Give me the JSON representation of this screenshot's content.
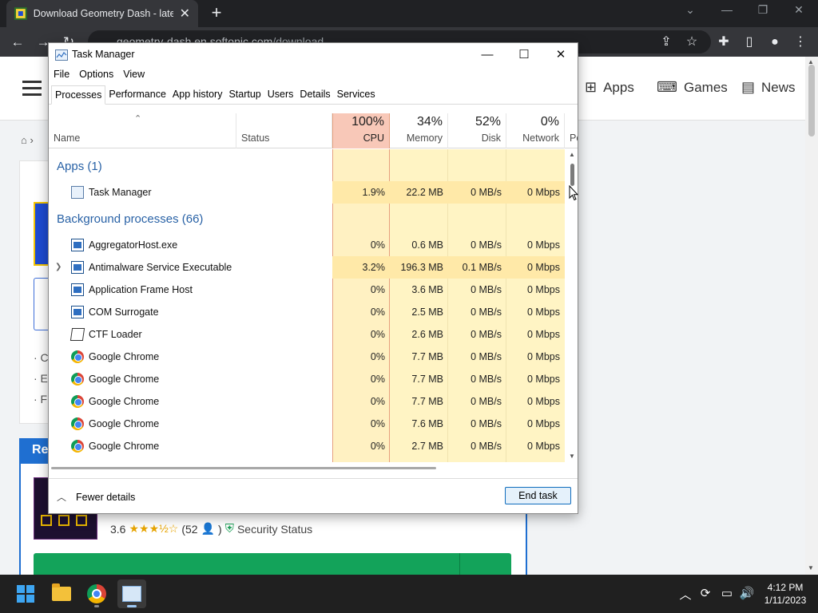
{
  "browser": {
    "tab_title": "Download Geometry Dash - latest",
    "new_tab_label": "+",
    "address_host": "geometry-dash.en.softonic.com",
    "address_path": "/download"
  },
  "site": {
    "nav": [
      {
        "label": "Apps",
        "icon": "apps-grid-icon"
      },
      {
        "label": "Games",
        "icon": "gamepad-icon"
      },
      {
        "label": "News",
        "icon": "news-icon"
      }
    ],
    "breadcrumb_home": "⌂ ›",
    "bullets": [
      "· C",
      "· E",
      "· F"
    ],
    "related_head": "Re",
    "rating": "3.6",
    "reviews": "(52",
    "reviews_close": ")",
    "security": "Security Status"
  },
  "taskmanager": {
    "title": "Task Manager",
    "menu": [
      "File",
      "Options",
      "View"
    ],
    "tabs": [
      "Processes",
      "Performance",
      "App history",
      "Startup",
      "Users",
      "Details",
      "Services"
    ],
    "columns": {
      "name": "Name",
      "status": "Status",
      "cpu_pct": "100%",
      "cpu": "CPU",
      "mem_pct": "34%",
      "mem": "Memory",
      "disk_pct": "52%",
      "disk": "Disk",
      "net_pct": "0%",
      "net": "Network",
      "power": "Po"
    },
    "groups": {
      "apps": "Apps (1)",
      "background": "Background processes (66)"
    },
    "app_rows": [
      {
        "name": "Task Manager",
        "cpu": "1.9%",
        "mem": "22.2 MB",
        "disk": "0 MB/s",
        "net": "0 Mbps"
      }
    ],
    "bg_rows": [
      {
        "name": "AggregatorHost.exe",
        "cpu": "0%",
        "mem": "0.6 MB",
        "disk": "0 MB/s",
        "net": "0 Mbps"
      },
      {
        "name": "Antimalware Service Executable",
        "cpu": "3.2%",
        "mem": "196.3 MB",
        "disk": "0.1 MB/s",
        "net": "0 Mbps"
      },
      {
        "name": "Application Frame Host",
        "cpu": "0%",
        "mem": "3.6 MB",
        "disk": "0 MB/s",
        "net": "0 Mbps"
      },
      {
        "name": "COM Surrogate",
        "cpu": "0%",
        "mem": "2.5 MB",
        "disk": "0 MB/s",
        "net": "0 Mbps"
      },
      {
        "name": "CTF Loader",
        "cpu": "0%",
        "mem": "2.6 MB",
        "disk": "0 MB/s",
        "net": "0 Mbps"
      },
      {
        "name": "Google Chrome",
        "cpu": "0%",
        "mem": "7.7 MB",
        "disk": "0 MB/s",
        "net": "0 Mbps"
      },
      {
        "name": "Google Chrome",
        "cpu": "0%",
        "mem": "7.7 MB",
        "disk": "0 MB/s",
        "net": "0 Mbps"
      },
      {
        "name": "Google Chrome",
        "cpu": "0%",
        "mem": "7.7 MB",
        "disk": "0 MB/s",
        "net": "0 Mbps"
      },
      {
        "name": "Google Chrome",
        "cpu": "0%",
        "mem": "7.6 MB",
        "disk": "0 MB/s",
        "net": "0 Mbps"
      },
      {
        "name": "Google Chrome",
        "cpu": "0%",
        "mem": "2.7 MB",
        "disk": "0 MB/s",
        "net": "0 Mbps"
      }
    ],
    "fewer_details": "Fewer details",
    "end_task": "End task"
  },
  "taskbar": {
    "time": "4:12 PM",
    "date": "1/11/2023"
  },
  "colors": {
    "cpu_header": "#f8c8b8",
    "heat_yellow": "#fff4c4",
    "group_blue": "#2962a6",
    "taskbar": "#202020"
  }
}
